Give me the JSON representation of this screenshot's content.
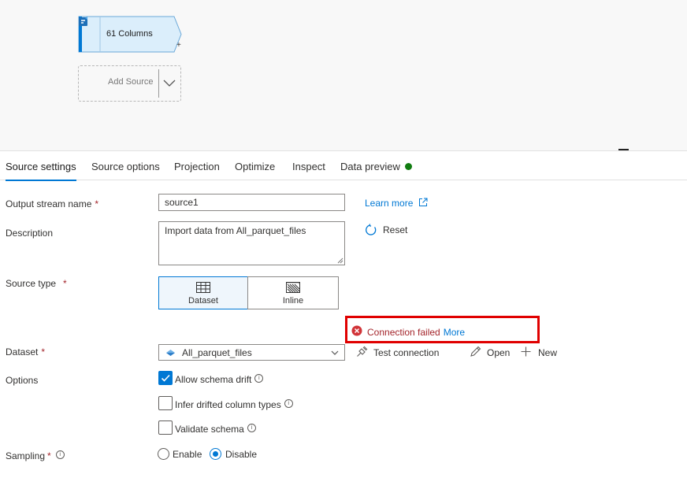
{
  "canvas": {
    "node_label": "61 Columns",
    "node_plus": "+",
    "add_source_label": "Add Source"
  },
  "tabs": [
    {
      "label": "Source settings"
    },
    {
      "label": "Source options"
    },
    {
      "label": "Projection"
    },
    {
      "label": "Optimize"
    },
    {
      "label": "Inspect"
    },
    {
      "label": "Data preview",
      "status_color": "#107c10"
    }
  ],
  "form": {
    "output_stream_label": "Output stream name",
    "output_stream_value": "source1",
    "required_mark": "*",
    "learn_more": "Learn more",
    "description_label": "Description",
    "description_value": "Import data from All_parquet_files",
    "reset": "Reset",
    "source_type_label": "Source type",
    "source_type_options": [
      "Dataset",
      "Inline"
    ],
    "source_type_selected": "Dataset",
    "error_text": "Connection failed",
    "error_more": "More",
    "dataset_label": "Dataset",
    "dataset_value": "All_parquet_files",
    "test_connection": "Test connection",
    "open": "Open",
    "new": "New",
    "options_label": "Options",
    "allow_schema_drift": "Allow schema drift",
    "allow_schema_drift_checked": true,
    "infer_drifted": "Infer drifted column types",
    "infer_drifted_checked": false,
    "validate_schema": "Validate schema",
    "validate_schema_checked": false,
    "sampling_label": "Sampling",
    "sampling_enable": "Enable",
    "sampling_disable": "Disable",
    "sampling_selected": "Disable"
  },
  "colors": {
    "accent": "#0078d4",
    "error": "#a4262c",
    "highlight_box": "#e00000",
    "status_ok": "#107c10"
  }
}
